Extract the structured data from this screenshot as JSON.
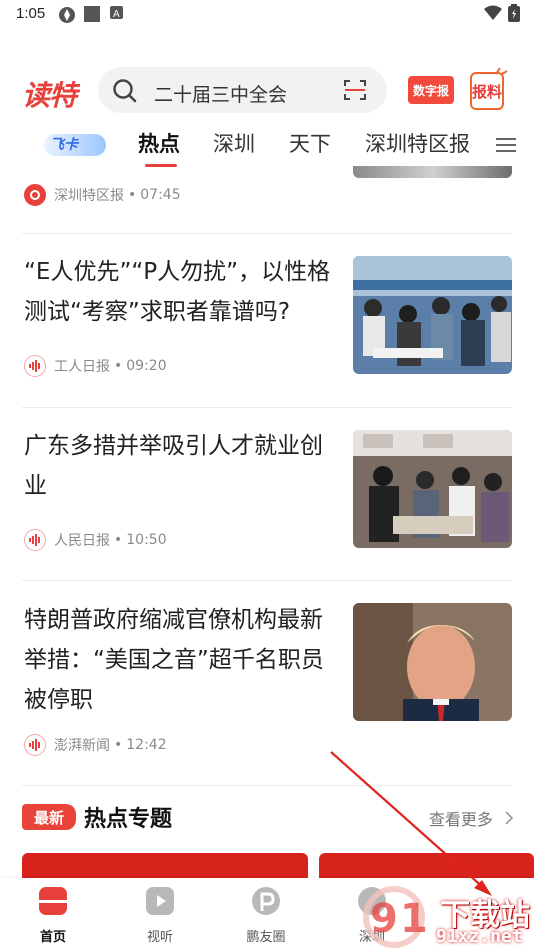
{
  "status_bar": {
    "time": "1:05"
  },
  "header": {
    "logo": "读特",
    "search_placeholder": "二十届三中全会",
    "digital_paper_label": "数字报",
    "report_label": "报料"
  },
  "tabs": [
    {
      "label": "飞卡"
    },
    {
      "label": "热点"
    },
    {
      "label": "深圳"
    },
    {
      "label": "天下"
    },
    {
      "label": "深圳特区报"
    }
  ],
  "feed": {
    "first_meta": {
      "source": "深圳特区报",
      "time": "07:45"
    },
    "articles": [
      {
        "title": "“E人优先”“P人勿扰”，以性格测试“考察”求职者靠谱吗?",
        "source": "工人日报",
        "time": "09:20"
      },
      {
        "title": "广东多措并举吸引人才就业创业",
        "source": "人民日报",
        "time": "10:50"
      },
      {
        "title": "特朗普政府缩减官僚机构最新举措：“美国之音”超千名职员被停职",
        "source": "澎湃新闻",
        "time": "12:42"
      }
    ]
  },
  "topics": {
    "badge": "最新",
    "title": "热点专题",
    "see_more": "查看更多"
  },
  "bottom_nav": [
    {
      "label": "首页"
    },
    {
      "label": "视听"
    },
    {
      "label": "鹏友圈"
    },
    {
      "label": "深圳"
    }
  ],
  "watermark": {
    "text": "下载站",
    "url": "91xz.net"
  },
  "colors": {
    "brand": "#e8403b",
    "accent_blue": "#2d6be8"
  }
}
